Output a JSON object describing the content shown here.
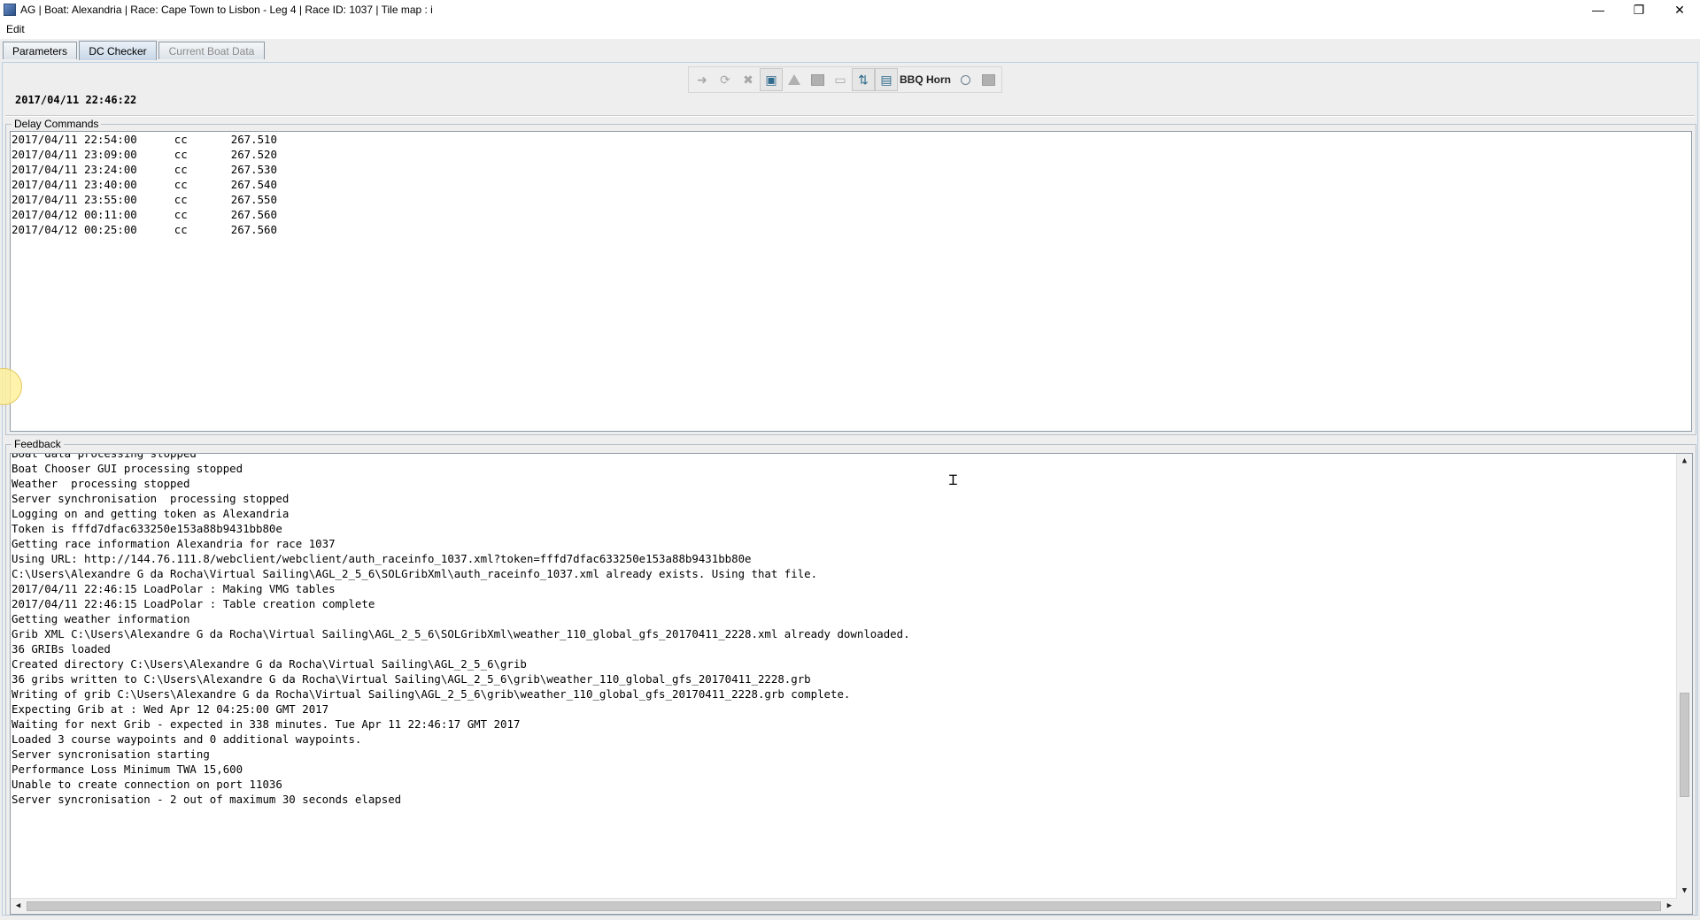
{
  "window": {
    "title": "AG  | Boat: Alexandria | Race: Cape Town to Lisbon - Leg 4 | Race ID: 1037 | Tile map : i",
    "minimize": "—",
    "maximize": "❐",
    "close": "✕"
  },
  "menu": {
    "edit": "Edit"
  },
  "tabs": {
    "parameters": "Parameters",
    "dc_checker": "DC Checker",
    "current_boat_data": "Current Boat Data"
  },
  "toolbar": {
    "bbq_label": "BBQ Horn",
    "icons": [
      "arrow-right-icon",
      "refresh-icon",
      "delete-icon",
      "save-icon",
      "warning-icon",
      "grid-icon",
      "map-icon",
      "chart-icon",
      "document-icon",
      "radio-icon",
      "box-icon"
    ]
  },
  "timestamp": "2017/04/11 22:46:22",
  "delay_commands": {
    "title": "Delay Commands",
    "rows": [
      {
        "time": "2017/04/11 22:54:00",
        "cmd": "cc",
        "value": "267.510"
      },
      {
        "time": "2017/04/11 23:09:00",
        "cmd": "cc",
        "value": "267.520"
      },
      {
        "time": "2017/04/11 23:24:00",
        "cmd": "cc",
        "value": "267.530"
      },
      {
        "time": "2017/04/11 23:40:00",
        "cmd": "cc",
        "value": "267.540"
      },
      {
        "time": "2017/04/11 23:55:00",
        "cmd": "cc",
        "value": "267.550"
      },
      {
        "time": "2017/04/12 00:11:00",
        "cmd": "cc",
        "value": "267.560"
      },
      {
        "time": "2017/04/12 00:25:00",
        "cmd": "cc",
        "value": "267.560"
      }
    ]
  },
  "feedback": {
    "title": "Feedback",
    "lines": [
      "Boat data processing stopped",
      "Boat Chooser GUI processing stopped",
      "Weather  processing stopped",
      "Server synchronisation  processing stopped",
      "Logging on and getting token as Alexandria",
      "Token is fffd7dfac633250e153a88b9431bb80e",
      "Getting race information Alexandria for race 1037",
      "Using URL: http://144.76.111.8/webclient/webclient/auth_raceinfo_1037.xml?token=fffd7dfac633250e153a88b9431bb80e",
      "C:\\Users\\Alexandre G da Rocha\\Virtual Sailing\\AGL_2_5_6\\SOLGribXml\\auth_raceinfo_1037.xml already exists. Using that file.",
      "2017/04/11 22:46:15 LoadPolar : Making VMG tables",
      "2017/04/11 22:46:15 LoadPolar : Table creation complete",
      "Getting weather information",
      "Grib XML C:\\Users\\Alexandre G da Rocha\\Virtual Sailing\\AGL_2_5_6\\SOLGribXml\\weather_110_global_gfs_20170411_2228.xml already downloaded.",
      "36 GRIBs loaded",
      "Created directory C:\\Users\\Alexandre G da Rocha\\Virtual Sailing\\AGL_2_5_6\\grib",
      "36 gribs written to C:\\Users\\Alexandre G da Rocha\\Virtual Sailing\\AGL_2_5_6\\grib\\weather_110_global_gfs_20170411_2228.grb",
      "Writing of grib C:\\Users\\Alexandre G da Rocha\\Virtual Sailing\\AGL_2_5_6\\grib\\weather_110_global_gfs_20170411_2228.grb complete.",
      "Expecting Grib at : Wed Apr 12 04:25:00 GMT 2017",
      "Waiting for next Grib - expected in 338 minutes. Tue Apr 11 22:46:17 GMT 2017",
      "Loaded 3 course waypoints and 0 additional waypoints.",
      "Server syncronisation starting",
      "Performance Loss Minimum TWA 15,600",
      "Unable to create connection on port 11036",
      "Server syncronisation - 2 out of maximum 30 seconds elapsed"
    ]
  }
}
